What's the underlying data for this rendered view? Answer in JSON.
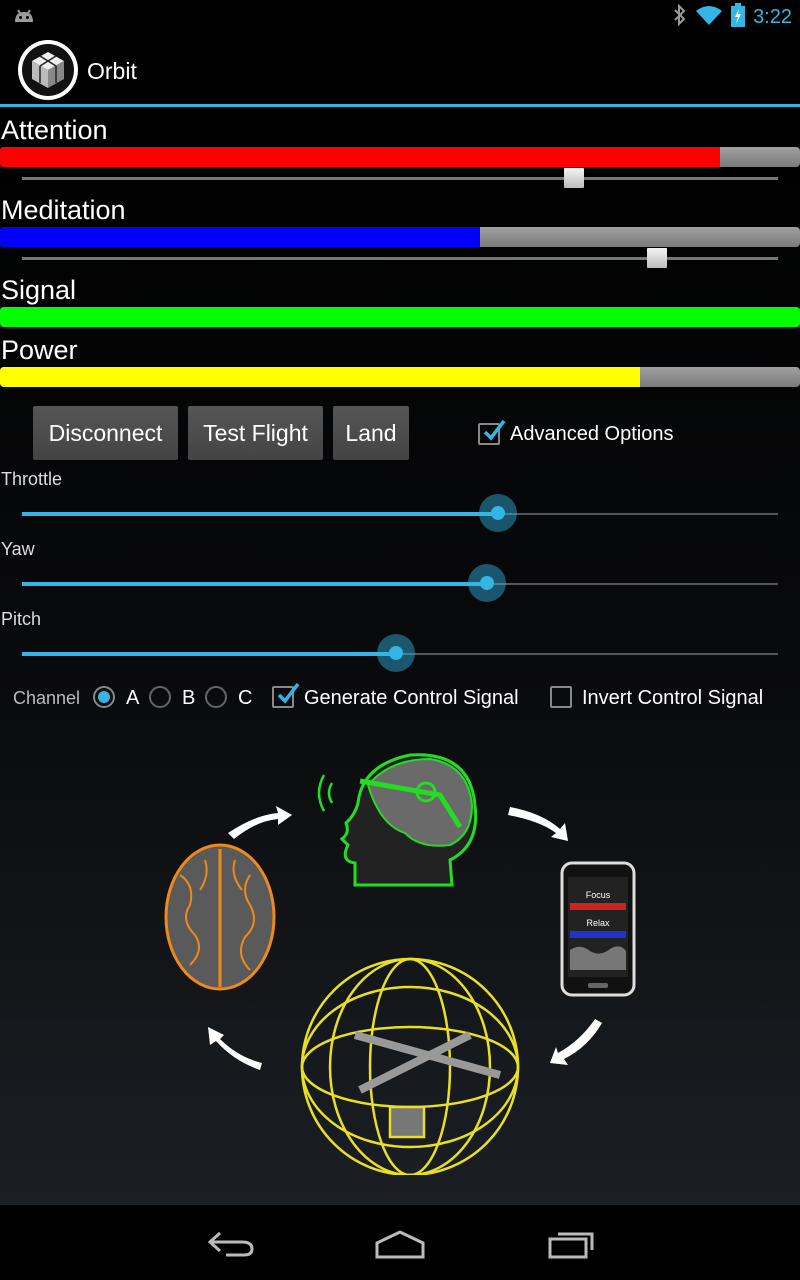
{
  "status_bar": {
    "time": "3:22",
    "icons": [
      "android-icon",
      "bluetooth-icon",
      "wifi-icon",
      "battery-charging-icon"
    ]
  },
  "action_bar": {
    "title": "Orbit",
    "logo_icon": "cube-logo-icon"
  },
  "meters": [
    {
      "label": "Attention",
      "value": 0.9,
      "color": "#ff0000",
      "threshold": 0.73
    },
    {
      "label": "Meditation",
      "value": 0.6,
      "color": "#0000ff",
      "threshold": 0.84
    },
    {
      "label": "Signal",
      "value": 1.0,
      "color": "#00ff00"
    },
    {
      "label": "Power",
      "value": 0.8,
      "color": "#ffff00"
    }
  ],
  "buttons": {
    "disconnect": "Disconnect",
    "test_flight": "Test Flight",
    "land": "Land"
  },
  "advanced_options": {
    "label": "Advanced Options",
    "checked": true
  },
  "sliders": [
    {
      "label": "Throttle",
      "value": 0.63
    },
    {
      "label": "Yaw",
      "value": 0.615
    },
    {
      "label": "Pitch",
      "value": 0.495
    }
  ],
  "channel": {
    "label": "Channel",
    "options": [
      "A",
      "B",
      "C"
    ],
    "selected": "A"
  },
  "generate_control_signal": {
    "label": "Generate Control Signal",
    "checked": true
  },
  "invert_control_signal": {
    "label": "Invert Control Signal",
    "checked": false
  },
  "illustration": {
    "phone_focus": "Focus",
    "phone_relax": "Relax",
    "colors": {
      "head": "#22dd22",
      "brain": "#ee8a1a",
      "orb": "#e8e020"
    }
  },
  "nav_bar": {
    "icons": [
      "back-icon",
      "home-icon",
      "recents-icon"
    ]
  },
  "colors": {
    "accent": "#33b5e5"
  }
}
